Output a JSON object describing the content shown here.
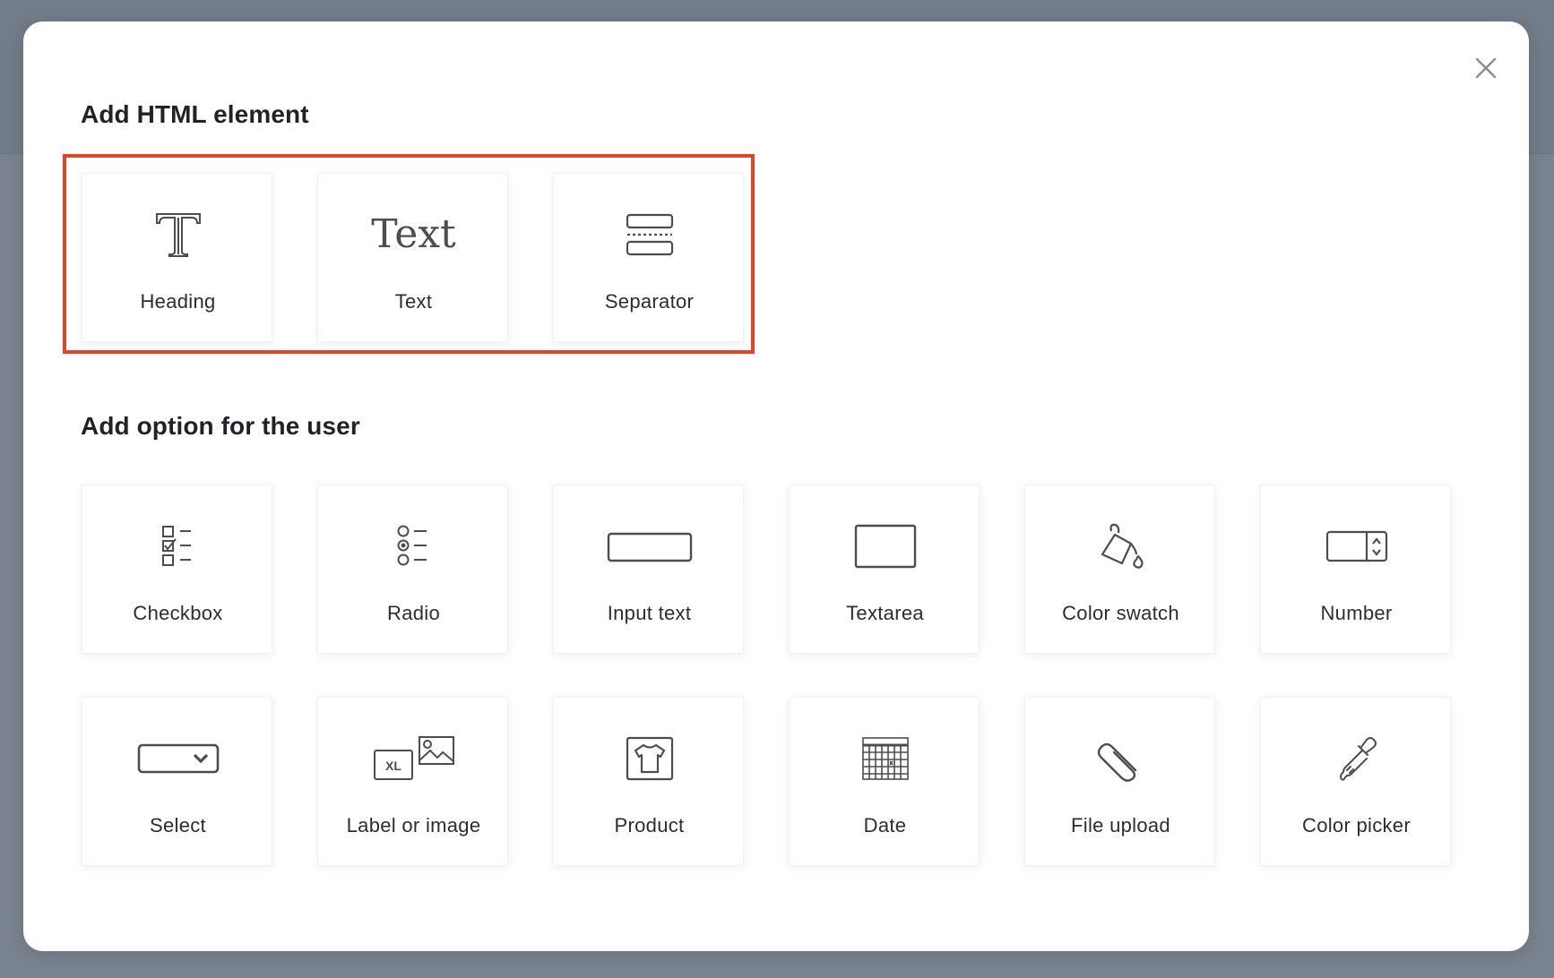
{
  "dialog": {
    "close_icon": "close-icon"
  },
  "sections": {
    "html_title": "Add HTML element",
    "option_title": "Add option for the user"
  },
  "html_elements": [
    {
      "label": "Heading",
      "icon": "heading-icon"
    },
    {
      "label": "Text",
      "icon": "text-icon",
      "icon_text": "Text"
    },
    {
      "label": "Separator",
      "icon": "separator-icon"
    }
  ],
  "user_options": [
    {
      "label": "Checkbox",
      "icon": "checkbox-list-icon"
    },
    {
      "label": "Radio",
      "icon": "radio-list-icon"
    },
    {
      "label": "Input text",
      "icon": "input-text-icon"
    },
    {
      "label": "Textarea",
      "icon": "textarea-icon"
    },
    {
      "label": "Color swatch",
      "icon": "paint-bucket-icon"
    },
    {
      "label": "Number",
      "icon": "number-stepper-icon"
    },
    {
      "label": "Select",
      "icon": "select-dropdown-icon"
    },
    {
      "label": "Label or image",
      "icon": "label-image-icon",
      "icon_text": "XL"
    },
    {
      "label": "Product",
      "icon": "tshirt-icon"
    },
    {
      "label": "Date",
      "icon": "calendar-icon"
    },
    {
      "label": "File upload",
      "icon": "paperclip-icon"
    },
    {
      "label": "Color picker",
      "icon": "eyedropper-icon"
    }
  ],
  "colors": {
    "highlight_border": "#e0442b",
    "backdrop": "#737d89",
    "icon_stroke": "#4a4e53"
  }
}
